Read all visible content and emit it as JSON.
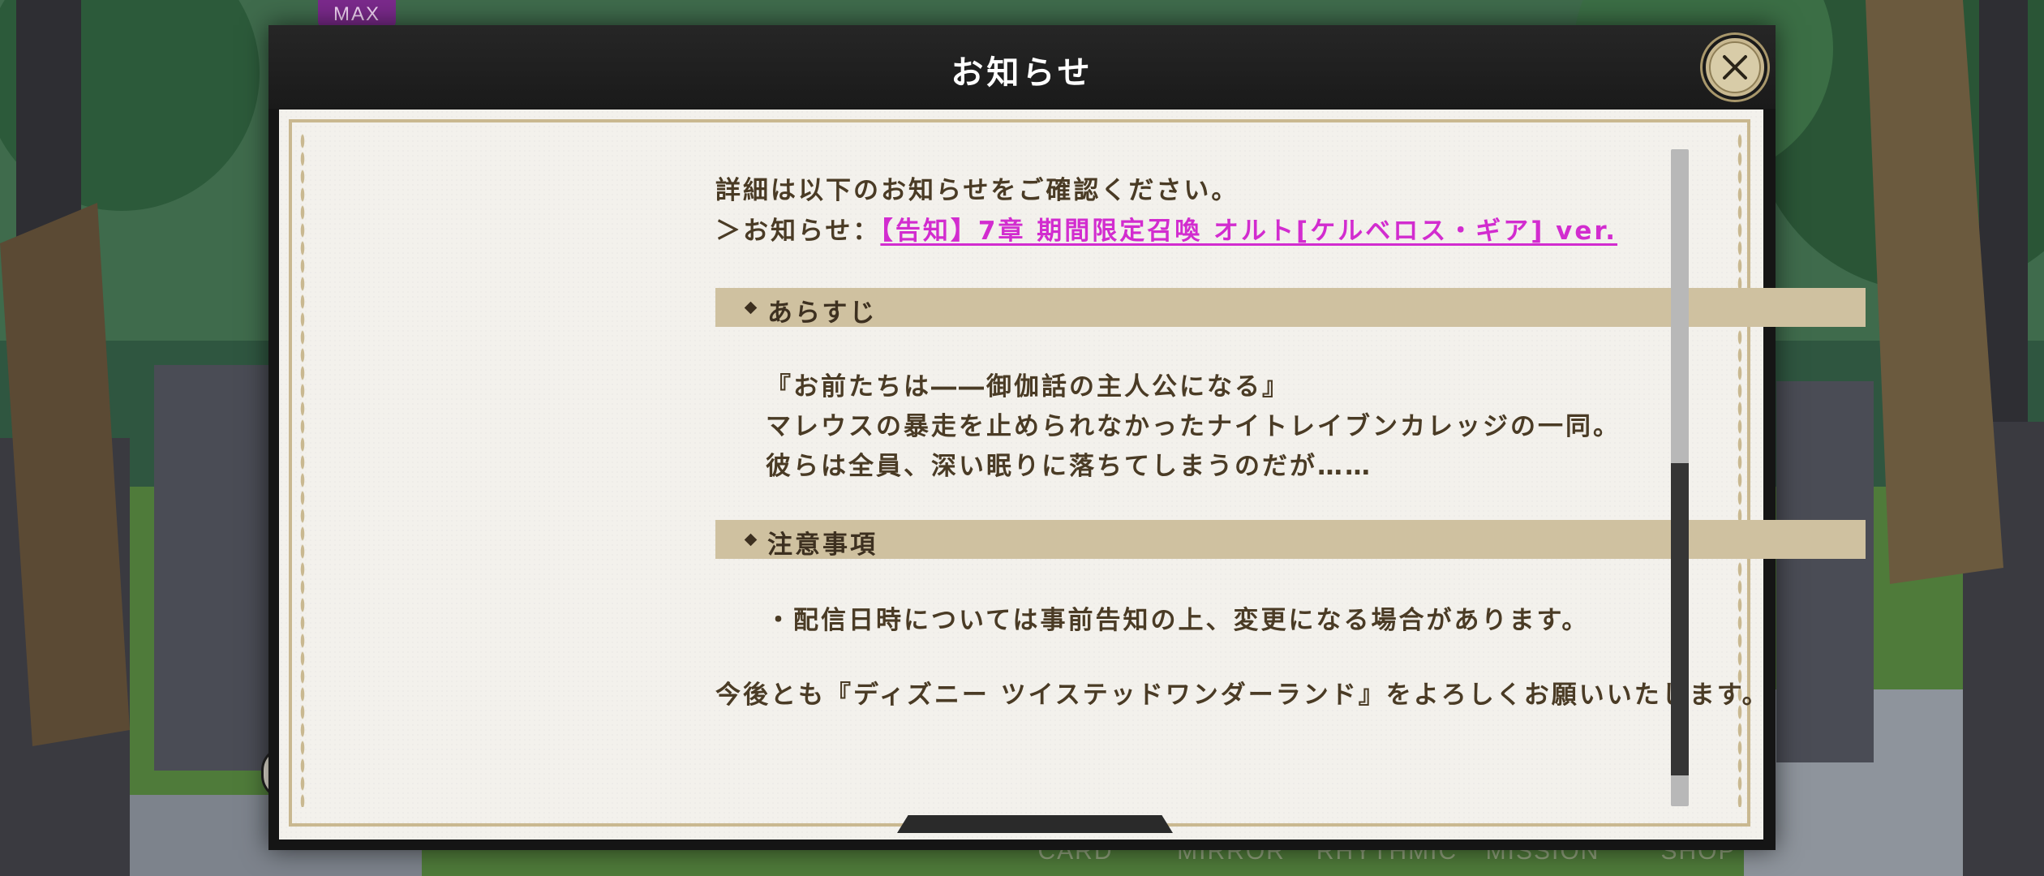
{
  "game_badge": "MAX",
  "bottom_nav": [
    "CARD",
    "MIRROR",
    "RHYTHMIC",
    "MISSION",
    "SHOP"
  ],
  "modal": {
    "title": "お知らせ",
    "close_icon": "close-x-icon",
    "intro_line": "詳細は以下のお知らせをご確認ください。",
    "link_prefix": "＞お知らせ：",
    "link_text": "【告知】7章 期間限定召喚 オルト[ケルベロス・ギア] ver.",
    "sections": [
      {
        "heading": "あらすじ",
        "lines": [
          "『お前たちは――御伽話の主人公になる』",
          "マレウスの暴走を止められなかったナイトレイブンカレッジの一同。",
          "彼らは全員、深い眠りに落ちてしまうのだが……"
        ]
      },
      {
        "heading": "注意事項",
        "lines": [
          "・配信日時については事前告知の上、変更になる場合があります。"
        ]
      }
    ],
    "closing": "今後とも『ディズニー ツイステッドワンダーランド』をよろしくお願いいたします。"
  },
  "colors": {
    "link": "#d22ccf",
    "section_bar": "#cfc1a0",
    "text": "#4a3b25",
    "paper": "#f3f1ec"
  }
}
